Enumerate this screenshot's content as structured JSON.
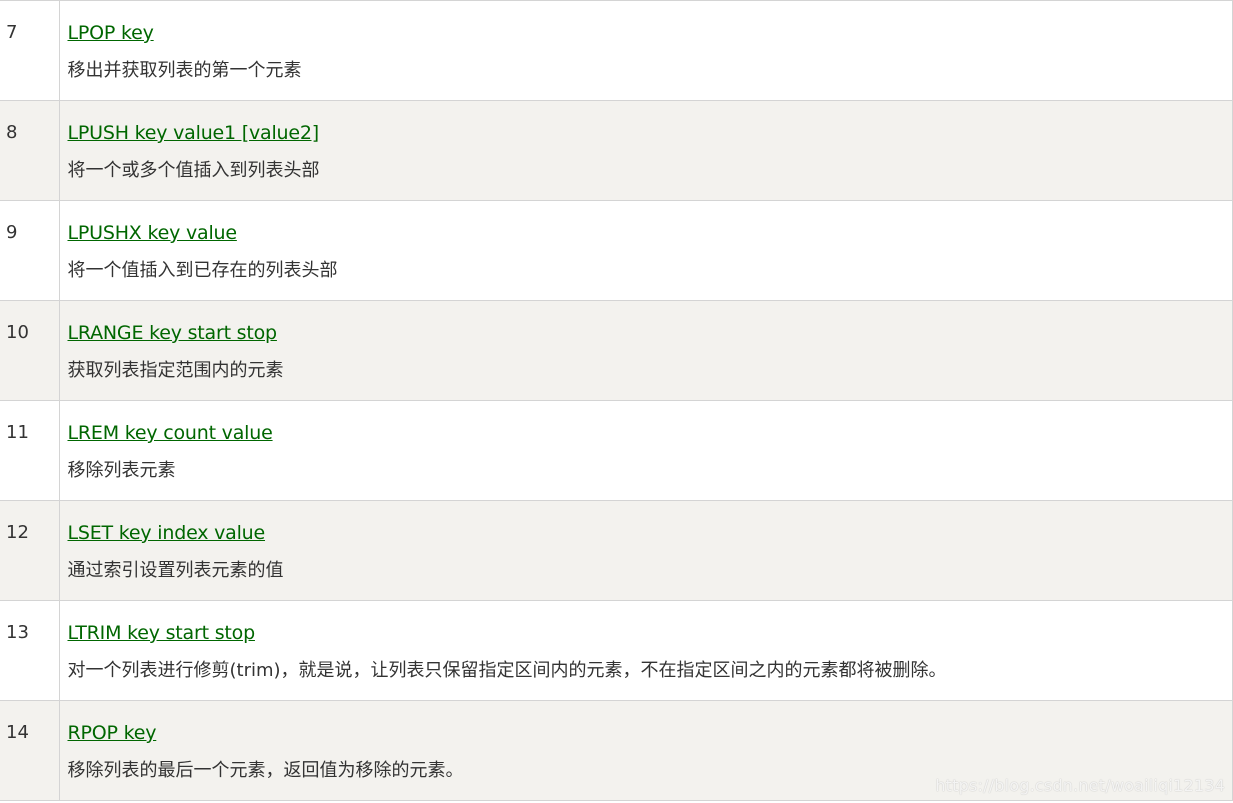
{
  "commands": [
    {
      "num": "7",
      "link": "LPOP key",
      "desc": "移出并获取列表的第一个元素"
    },
    {
      "num": "8",
      "link": "LPUSH key value1 [value2]",
      "desc": "将一个或多个值插入到列表头部"
    },
    {
      "num": "9",
      "link": "LPUSHX key value",
      "desc": "将一个值插入到已存在的列表头部"
    },
    {
      "num": "10",
      "link": "LRANGE key start stop",
      "desc": "获取列表指定范围内的元素"
    },
    {
      "num": "11",
      "link": "LREM key count value",
      "desc": "移除列表元素"
    },
    {
      "num": "12",
      "link": "LSET key index value",
      "desc": "通过索引设置列表元素的值"
    },
    {
      "num": "13",
      "link": "LTRIM key start stop",
      "desc": "对一个列表进行修剪(trim)，就是说，让列表只保留指定区间内的元素，不在指定区间之内的元素都将被删除。"
    },
    {
      "num": "14",
      "link": "RPOP key",
      "desc": "移除列表的最后一个元素，返回值为移除的元素。"
    }
  ],
  "watermark": "https://blog.csdn.net/woailiqi12134",
  "colors": {
    "link": "#006600",
    "alt_row_bg": "#f3f2ee",
    "border": "#d4d4d4",
    "text": "#333333"
  }
}
